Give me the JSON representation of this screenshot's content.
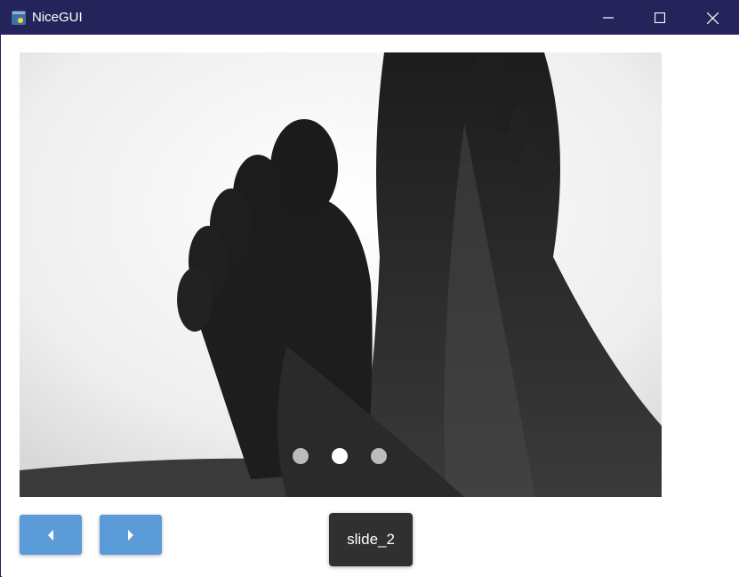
{
  "window": {
    "title": "NiceGUI",
    "app_icon": "python-icon",
    "controls": [
      "minimize-icon",
      "maximize-icon",
      "close-icon"
    ],
    "titlebar_color": "#25245a"
  },
  "carousel": {
    "image": "black-and-white-photo-of-feet",
    "slide_count": 3,
    "active_index": 1
  },
  "buttons": {
    "prev_icon": "arrow-left-icon",
    "next_icon": "arrow-right-icon",
    "color": "#5b9bd8"
  },
  "current_slide": {
    "label": "slide_2"
  }
}
